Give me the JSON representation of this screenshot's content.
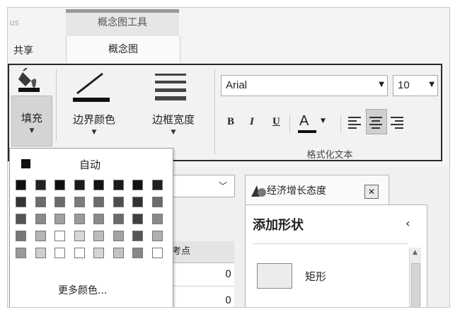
{
  "app": {
    "left_cut_text": "us",
    "contextual_group": "概念图工具",
    "tabs": [
      {
        "label": "共享",
        "active": false
      },
      {
        "label": "概念图",
        "active": true
      }
    ]
  },
  "ribbon": {
    "fill_label": "填充",
    "border_color_label": "边界颜色",
    "border_width_label": "边框宽度",
    "font_name": "Arial",
    "font_size": "10",
    "bold": "B",
    "italic": "I",
    "underline": "U",
    "font_color_letter": "A",
    "group_label": "格式化文本",
    "icons": [
      "paint-bucket-icon",
      "line-color-icon",
      "line-width-icon",
      "align-left-icon",
      "align-center-icon",
      "align-right-icon"
    ]
  },
  "color_popup": {
    "automatic_label": "自动",
    "more_colors_label": "更多颜色...",
    "palette": [
      [
        "#111111",
        "#232323",
        "#111111",
        "#1a1a1a",
        "#111111",
        "#1a1a1a",
        "#111111",
        "#1f1f1f"
      ],
      [
        "#333333",
        "#6b6b6b",
        "#6b6b6b",
        "#7a7a7a",
        "#6b6b6b",
        "#4d4d4d",
        "#333333",
        "#6b6b6b"
      ],
      [
        "#555555",
        "#8a8a8a",
        "#a0a0a0",
        "#9b9b9b",
        "#8a8a8a",
        "#6b6b6b",
        "#404040",
        "#8a8a8a"
      ],
      [
        "#777777",
        "#b5b5b5",
        "#ffffff",
        "#d8d8d8",
        "#bdbdbd",
        "#a3a3a3",
        "#555555",
        "#b0b0b0"
      ],
      [
        "#999999",
        "#cfcfcf",
        "#ffffff",
        "#ffffff",
        "#d6d6d6",
        "#c4c4c4",
        "#888888",
        "#ffffff"
      ]
    ]
  },
  "table": {
    "column_header": "考点",
    "row_value": "0",
    "row2_value": "0"
  },
  "doc_tab": {
    "title": "经济增长态度"
  },
  "shape_panel": {
    "title": "添加形状",
    "shapes": [
      {
        "label": "矩形"
      }
    ]
  }
}
